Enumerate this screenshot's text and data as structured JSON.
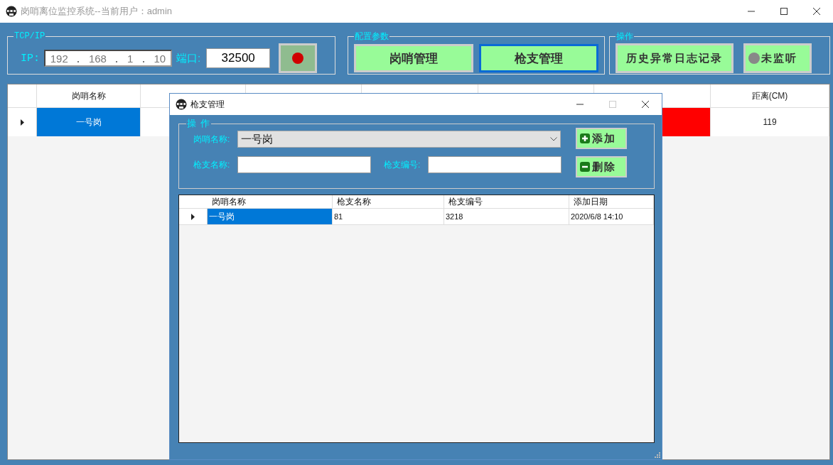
{
  "window": {
    "title": "岗哨离位监控系统--当前用户：admin"
  },
  "tcp_group": {
    "legend": "TCP/IP",
    "ip_label": "IP:",
    "ip_octets": [
      "192",
      "168",
      "1",
      "10"
    ],
    "port_label": "端口:",
    "port_value": "32500",
    "record_on": true
  },
  "config_group": {
    "legend": "配置参数",
    "buttons": [
      {
        "label": "岗哨管理",
        "selected": false
      },
      {
        "label": "枪支管理",
        "selected": true
      }
    ]
  },
  "ops_group": {
    "legend": "操作",
    "log_button": "历史异常日志记录",
    "listen_button": {
      "label": "未监听",
      "on": false
    }
  },
  "table": {
    "columns": [
      "岗哨名称",
      "距离(CM)"
    ],
    "rows": [
      {
        "current": true,
        "name": "一号岗",
        "selected": true,
        "alarm": true,
        "distance": "119"
      }
    ]
  },
  "dialog": {
    "title": "枪支管理",
    "group_legend": "操 作",
    "post_label": "岗哨名称:",
    "post_value": "一号岗",
    "gun_name_label": "枪支名称:",
    "gun_number_label": "枪支编号:",
    "add_button": "添加",
    "delete_button": "删除",
    "table": {
      "columns": [
        "岗哨名称",
        "枪支名称",
        "枪支编号",
        "添加日期"
      ],
      "rows": [
        {
          "current": true,
          "selected": true,
          "cells": [
            "一号岗",
            "81",
            "3218",
            "2020/6/8 14:10"
          ]
        }
      ]
    }
  }
}
